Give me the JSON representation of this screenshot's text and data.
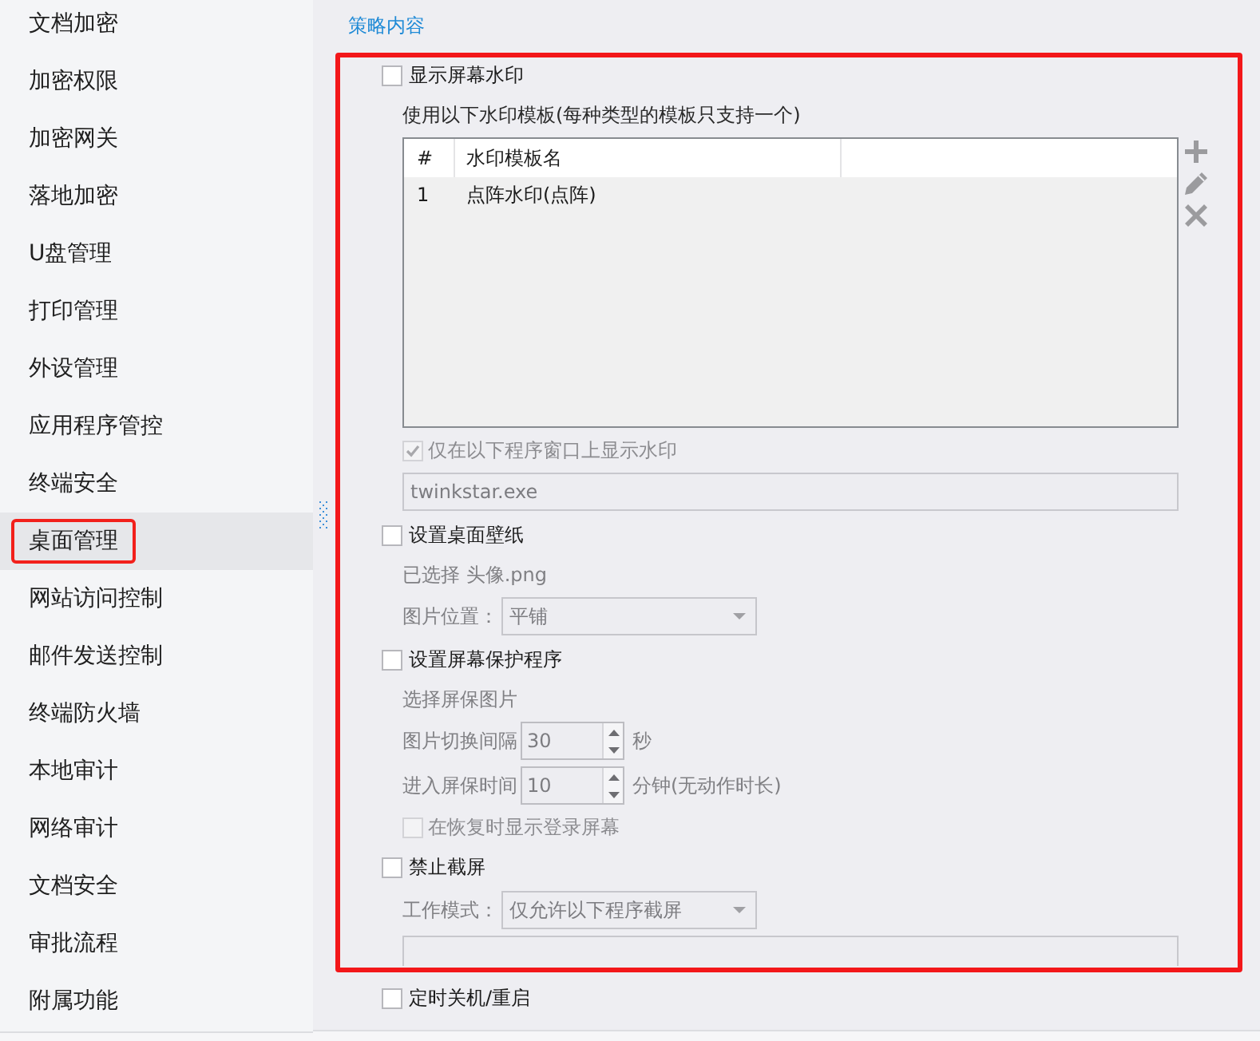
{
  "sidebar": {
    "items": [
      {
        "label": "文档加密",
        "selected": false,
        "highlighted": false
      },
      {
        "label": "加密权限",
        "selected": false,
        "highlighted": false
      },
      {
        "label": "加密网关",
        "selected": false,
        "highlighted": false
      },
      {
        "label": "落地加密",
        "selected": false,
        "highlighted": false
      },
      {
        "label": "U盘管理",
        "selected": false,
        "highlighted": false
      },
      {
        "label": "打印管理",
        "selected": false,
        "highlighted": false
      },
      {
        "label": "外设管理",
        "selected": false,
        "highlighted": false
      },
      {
        "label": "应用程序管控",
        "selected": false,
        "highlighted": false
      },
      {
        "label": "终端安全",
        "selected": false,
        "highlighted": false
      },
      {
        "label": "桌面管理",
        "selected": true,
        "highlighted": true
      },
      {
        "label": "网站访问控制",
        "selected": false,
        "highlighted": false
      },
      {
        "label": "邮件发送控制",
        "selected": false,
        "highlighted": false
      },
      {
        "label": "终端防火墙",
        "selected": false,
        "highlighted": false
      },
      {
        "label": "本地审计",
        "selected": false,
        "highlighted": false
      },
      {
        "label": "网络审计",
        "selected": false,
        "highlighted": false
      },
      {
        "label": "文档安全",
        "selected": false,
        "highlighted": false
      },
      {
        "label": "审批流程",
        "selected": false,
        "highlighted": false
      },
      {
        "label": "附属功能",
        "selected": false,
        "highlighted": false
      }
    ]
  },
  "content": {
    "title": "策略内容",
    "sections": [
      {
        "label": "显示屏幕水印",
        "checked": false,
        "highlighted": true,
        "children": [
          {
            "kind": "note",
            "text": "使用以下水印模板(每种类型的模板只支持一个)",
            "disabled": false
          },
          {
            "kind": "table",
            "columns": [
              "#",
              "水印模板名"
            ],
            "rows": [
              [
                "1",
                "点阵水印(点阵)"
              ]
            ]
          },
          {
            "kind": "checkbox",
            "label": "仅在以下程序窗口上显示水印",
            "checked": true,
            "disabled": true
          },
          {
            "kind": "input",
            "value": "twinkstar.exe",
            "disabled": true
          }
        ]
      },
      {
        "label": "设置桌面壁纸",
        "checked": false,
        "highlighted": true,
        "children": [
          {
            "kind": "note",
            "text": "已选择 头像.png",
            "disabled": true
          },
          {
            "kind": "select",
            "label": "图片位置：",
            "value": "平铺",
            "disabled": true
          }
        ]
      },
      {
        "label": "设置屏幕保护程序",
        "checked": false,
        "highlighted": true,
        "children": [
          {
            "kind": "note",
            "text": "选择屏保图片",
            "disabled": true
          },
          {
            "kind": "spinner",
            "label": "图片切换间隔",
            "value": "30",
            "unit": "秒",
            "disabled": true
          },
          {
            "kind": "spinner",
            "label": "进入屏保时间",
            "value": "10",
            "unit": "分钟(无动作时长)",
            "disabled": true
          },
          {
            "kind": "checkbox",
            "label": "在恢复时显示登录屏幕",
            "checked": false,
            "disabled": true
          }
        ]
      },
      {
        "label": "禁止截屏",
        "checked": false,
        "highlighted": true,
        "children": [
          {
            "kind": "select",
            "label": "工作模式：",
            "value": "仅允许以下程序截屏",
            "disabled": true
          },
          {
            "kind": "textarea",
            "disabled": true
          }
        ]
      },
      {
        "label": "定时关机/重启",
        "checked": false,
        "highlighted": false
      }
    ]
  }
}
